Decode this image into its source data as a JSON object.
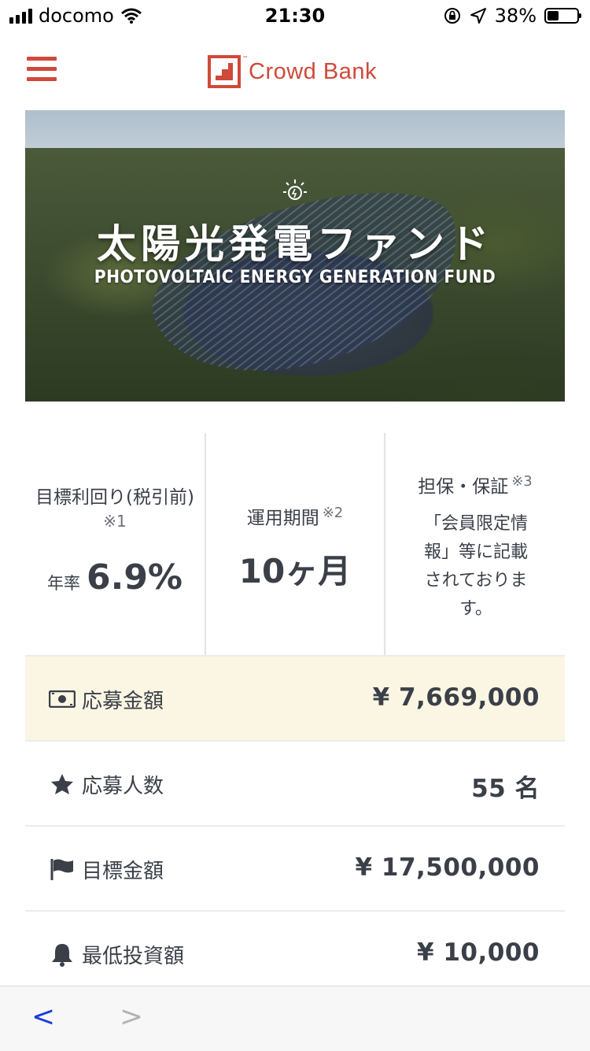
{
  "status_bar": {
    "carrier": "docomo",
    "time": "21:30",
    "battery_percent": "38%",
    "battery_level": 0.38
  },
  "header": {
    "menu_icon": "hamburger-icon",
    "brand_name": "Crowd Bank",
    "brand_tm": "™",
    "brand_color": "#d0493a"
  },
  "hero": {
    "title": "太陽光発電ファンド",
    "subtitle": "PHOTOVOLTAIC ENERGY GENERATION FUND"
  },
  "summary": {
    "yield": {
      "label": "目標利回り(税引前)",
      "note": "※1",
      "prefix": "年率",
      "value": "6.9%"
    },
    "period": {
      "label": "運用期間",
      "note": "※2",
      "value": "10ヶ月"
    },
    "guarantee": {
      "label": "担保・保証",
      "note": "※3",
      "description": "「会員限定情報」等に記載されております。"
    }
  },
  "rows": [
    {
      "icon": "money-icon",
      "label": "応募金額",
      "value": "¥ 7,669,000"
    },
    {
      "icon": "star-icon",
      "label": "応募人数",
      "value": "55 名"
    },
    {
      "icon": "flag-icon",
      "label": "目標金額",
      "value": "¥ 17,500,000"
    },
    {
      "icon": "bell-icon",
      "label": "最低投資額",
      "value": "¥ 10,000"
    }
  ],
  "toolbar": {
    "back": "<",
    "forward": ">"
  },
  "colors": {
    "accent": "#d0493a",
    "highlight_row": "#faf6e3",
    "text": "#3a3f48",
    "link_blue": "#1a3ed8"
  }
}
